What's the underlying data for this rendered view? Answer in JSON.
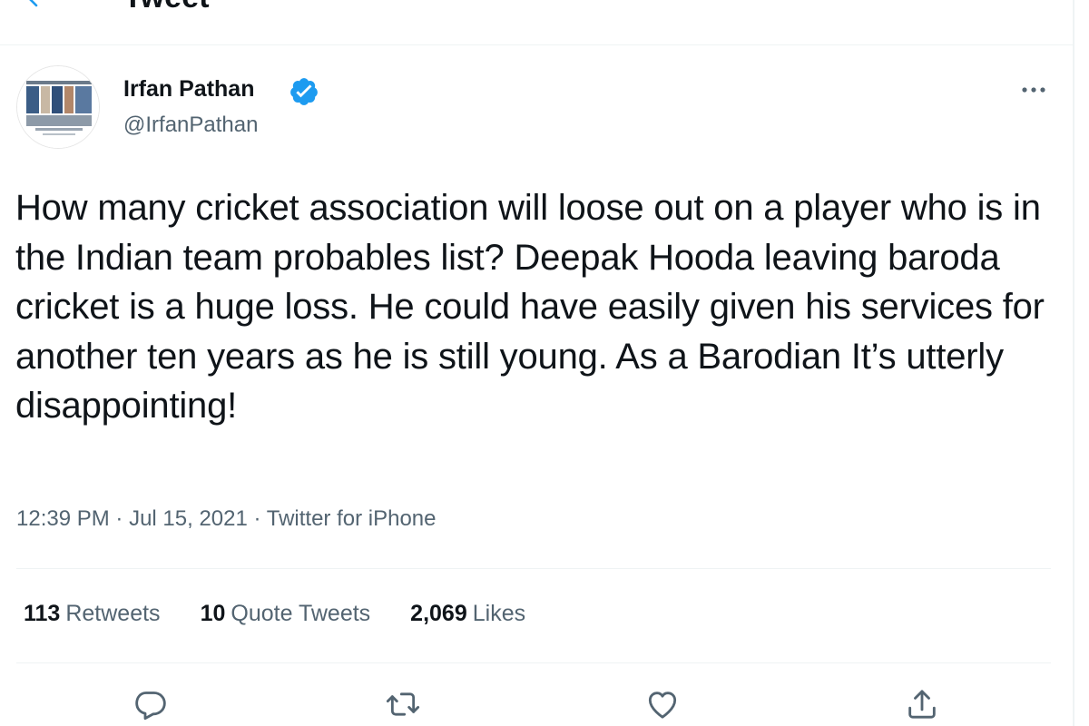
{
  "header": {
    "title": "Tweet",
    "back_icon": "arrow-left-icon"
  },
  "author": {
    "name": "Irfan Pathan",
    "handle": "@IrfanPathan",
    "verified_icon": "verified-badge-icon",
    "accent_color": "#1d9bf0"
  },
  "tweet": {
    "text": "How many cricket association will loose out on a player who is in the Indian team probables list? Deepak Hooda leaving baroda cricket is a huge loss. He could have easily given his services for another ten years as he is still young. As a Barodian It’s utterly disappointing!"
  },
  "meta": {
    "time": "12:39 PM",
    "separator1": " · ",
    "date": "Jul 15, 2021",
    "separator2": " · ",
    "source": "Twitter for iPhone"
  },
  "stats": {
    "retweets_count": "113",
    "retweets_label": "Retweets",
    "quotes_count": "10",
    "quotes_label": "Quote Tweets",
    "likes_count": "2,069",
    "likes_label": "Likes"
  },
  "actions": [
    "reply-icon",
    "retweet-icon",
    "like-icon",
    "share-icon"
  ],
  "colors": {
    "text": "#0f1419",
    "secondary": "#536471",
    "border": "#eff3f4"
  }
}
